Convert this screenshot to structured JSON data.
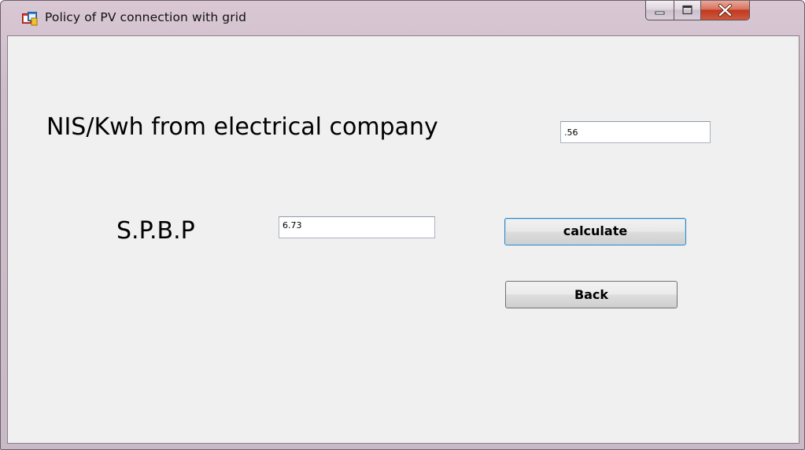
{
  "window": {
    "title": "Policy of PV connection with grid"
  },
  "form": {
    "rate_label": "NIS/Kwh from electrical company",
    "rate_value": ".56",
    "spbp_label": "S.P.B.P",
    "spbp_value": "6.73",
    "calculate_label": "calculate",
    "back_label": "Back"
  },
  "icons": {
    "app": "app-form-icon",
    "minimize": "minimize-icon",
    "maximize": "maximize-icon",
    "close": "close-icon"
  },
  "colors": {
    "client_bg": "#f0f0f0",
    "close_button": "#c0391f",
    "focus_border": "#3c7fb1"
  }
}
